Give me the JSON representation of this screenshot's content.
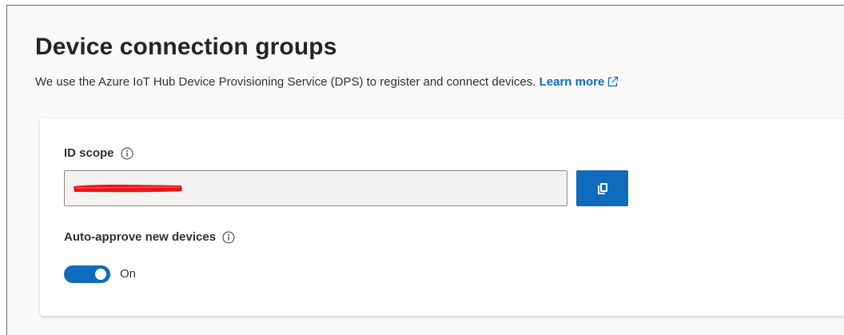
{
  "header": {
    "title": "Device connection groups",
    "description": "We use the Azure IoT Hub Device Provisioning Service (DPS) to register and connect devices.",
    "learn_more_label": "Learn more"
  },
  "id_scope": {
    "label": "ID scope",
    "value": ""
  },
  "auto_approve": {
    "label": "Auto-approve new devices",
    "state_label": "On"
  },
  "icons": {
    "info": "info-icon",
    "copy": "copy-icon",
    "external_link": "external-link-icon"
  },
  "colors": {
    "accent": "#0f6cbd",
    "redaction": "#e8141a"
  }
}
